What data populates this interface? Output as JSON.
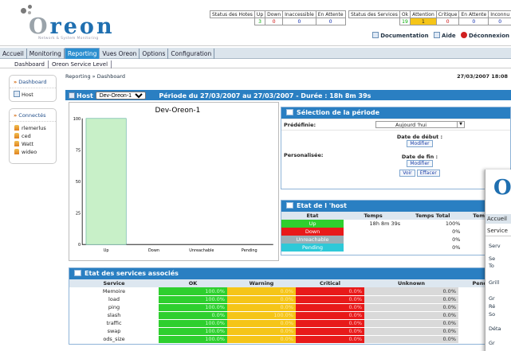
{
  "brand": {
    "name_o": "O",
    "name_rest": "reon",
    "tagline": "Network & System Monitoring"
  },
  "status_hosts": {
    "headers": [
      "Status des Hotes",
      "Up",
      "Down",
      "Inaccessible",
      "En Attente"
    ],
    "values": [
      "3",
      "0",
      "0",
      "0"
    ]
  },
  "status_services": {
    "headers": [
      "Status des Services",
      "Ok",
      "Attention",
      "Critique",
      "En Attente",
      "Inconnu"
    ],
    "values": [
      "19",
      "1",
      "0",
      "0",
      "0"
    ]
  },
  "header_links": {
    "doc": "Documentation",
    "help": "Aide",
    "logout": "Déconnexion"
  },
  "menu": [
    "Accueil",
    "Monitoring",
    "Reporting",
    "Vues Oreon",
    "Options",
    "Configuration"
  ],
  "submenu": [
    "Dashboard",
    "Oreon Service Level"
  ],
  "sidebar": {
    "dash_title": "Dashboard",
    "host_item": "Host",
    "conn_title": "Connectés",
    "users": [
      "rlemerlus",
      "ced",
      "Watt",
      "wideo"
    ]
  },
  "breadcrumb": "Reporting » Dashboard",
  "date": "27/03/2007 18:08",
  "hostbar": {
    "label": "Host",
    "selected": "Dev-Oreon-1",
    "period": "Période du 27/03/2007 au 27/03/2007 - Durée : 18h 8m 39s"
  },
  "chart_data": {
    "type": "bar",
    "title": "Dev-Oreon-1",
    "categories": [
      "Up",
      "Down",
      "Unreachable",
      "Pending"
    ],
    "values": [
      100,
      0,
      0,
      0
    ],
    "ylim": [
      0,
      100
    ],
    "yticks": [
      "100",
      "75",
      "50",
      "25",
      "0"
    ]
  },
  "selection": {
    "title": "Sélection de la période",
    "predef_label": "Prédéfinie:",
    "predef_value": "Aujourd 'hui",
    "custom_label": "Personalisée:",
    "start_label": "Date de début :",
    "end_label": "Date de fin :",
    "modify": "Modifier",
    "view": "Voir",
    "clear": "Effacer"
  },
  "host_state": {
    "title": "Etat de l 'host",
    "headers": [
      "Etat",
      "Temps",
      "Temps Total",
      "Temps co"
    ],
    "rows": [
      {
        "state": "Up",
        "time": "18h 8m 39s",
        "total": "100%",
        "color": "#2ecf2e"
      },
      {
        "state": "Down",
        "time": "",
        "total": "0%",
        "color": "#e81a1a"
      },
      {
        "state": "Unreachable",
        "time": "",
        "total": "0%",
        "color": "#9ab0b8"
      },
      {
        "state": "Pending",
        "time": "",
        "total": "0%",
        "color": "#2ec9d8"
      }
    ]
  },
  "services": {
    "title": "Etat des services associés",
    "headers": [
      "Service",
      "OK",
      "Warning",
      "Critical",
      "Unknown",
      "Pending"
    ],
    "rows": [
      {
        "name": "Memoire",
        "ok": "100.0%",
        "warn": "0.0%",
        "crit": "0.0%",
        "unk": "0.0%"
      },
      {
        "name": "load",
        "ok": "100.0%",
        "warn": "0.0%",
        "crit": "0.0%",
        "unk": "0.0%"
      },
      {
        "name": "ping",
        "ok": "100.0%",
        "warn": "0.0%",
        "crit": "0.0%",
        "unk": "0.0%"
      },
      {
        "name": "slash",
        "ok": "0.0%",
        "warn": "100.0%",
        "crit": "0.0%",
        "unk": "0.0%"
      },
      {
        "name": "traffic",
        "ok": "100.0%",
        "warn": "0.0%",
        "crit": "0.0%",
        "unk": "0.0%"
      },
      {
        "name": "swap",
        "ok": "100.0%",
        "warn": "0.0%",
        "crit": "0.0%",
        "unk": "0.0%"
      },
      {
        "name": "ods_size",
        "ok": "100.0%",
        "warn": "0.0%",
        "crit": "0.0%",
        "unk": "0.0%"
      }
    ]
  },
  "overlay": {
    "logo": "O",
    "menu": "Accueil",
    "sub": "Service",
    "lines": [
      "Serv",
      "Se",
      "To",
      "Grill",
      "Gr",
      "Ré",
      "So",
      "Déta",
      "Gr"
    ]
  }
}
